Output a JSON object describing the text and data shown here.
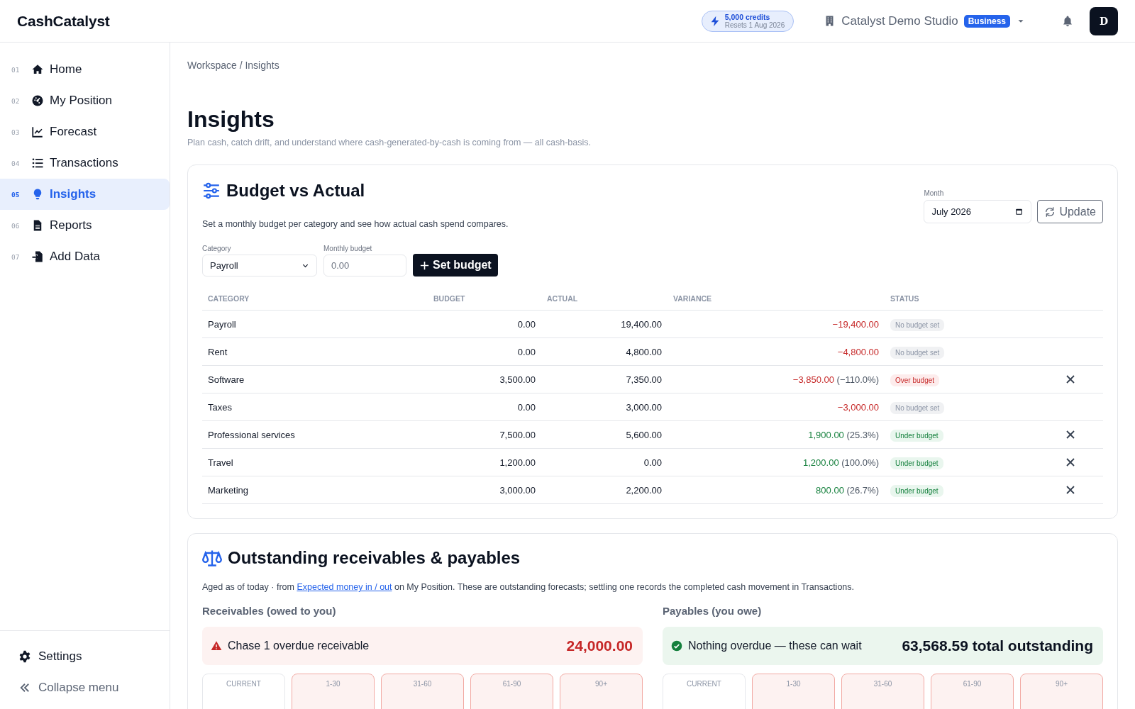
{
  "app": {
    "logo": "CashCatalyst"
  },
  "credits": {
    "amount": "5,000 credits",
    "reset": "Resets 1 Aug 2026"
  },
  "workspace": {
    "name": "Catalyst Demo Studio",
    "plan": "Business"
  },
  "user": {
    "initial": "D"
  },
  "sidebar": {
    "items": [
      {
        "number": "01",
        "label": "Home",
        "selected": false
      },
      {
        "number": "02",
        "label": "My Position",
        "selected": false
      },
      {
        "number": "03",
        "label": "Forecast",
        "selected": false
      },
      {
        "number": "04",
        "label": "Transactions",
        "selected": false
      },
      {
        "number": "05",
        "label": "Insights",
        "selected": true
      },
      {
        "number": "06",
        "label": "Reports",
        "selected": false
      },
      {
        "number": "07",
        "label": "Add Data",
        "selected": false
      }
    ],
    "footer": [
      {
        "label": "Settings"
      },
      {
        "label": "Collapse menu"
      }
    ]
  },
  "breadcrumb": "Workspace / Insights",
  "page": {
    "title": "Insights",
    "subtitle": "Plan cash, catch drift, and understand where cash-generated-by-cash is coming from — all cash-basis."
  },
  "budget": {
    "title": "Budget vs Actual",
    "description": "Set a monthly budget per category and see how actual cash spend compares.",
    "month": {
      "label": "Month",
      "value": "July 2026"
    },
    "update_button": "Update",
    "category": {
      "label": "Category",
      "value": "Payroll"
    },
    "monthly_budget": {
      "label": "Monthly budget",
      "placeholder": "0.00"
    },
    "set_button": "Set budget",
    "columns": [
      "CATEGORY",
      "BUDGET",
      "ACTUAL",
      "VARIANCE",
      "STATUS"
    ],
    "rows": [
      {
        "category": "Payroll",
        "budget": "0.00",
        "actual": "19,400.00",
        "variance": "−19,400.00",
        "status": "No budget set",
        "kind": "none",
        "removable": false
      },
      {
        "category": "Rent",
        "budget": "0.00",
        "actual": "4,800.00",
        "variance": "−4,800.00",
        "status": "No budget set",
        "kind": "none",
        "removable": false
      },
      {
        "category": "Software",
        "budget": "3,500.00",
        "actual": "7,350.00",
        "variance": "−3,850.00",
        "percent": "(−110.0%)",
        "status": "Over budget",
        "kind": "over",
        "removable": true
      },
      {
        "category": "Taxes",
        "budget": "0.00",
        "actual": "3,000.00",
        "variance": "−3,000.00",
        "status": "No budget set",
        "kind": "none",
        "removable": false
      },
      {
        "category": "Professional services",
        "budget": "7,500.00",
        "actual": "5,600.00",
        "variance": "1,900.00",
        "percent": "(25.3%)",
        "status": "Under budget",
        "kind": "under",
        "removable": true
      },
      {
        "category": "Travel",
        "budget": "1,200.00",
        "actual": "0.00",
        "variance": "1,200.00",
        "percent": "(100.0%)",
        "status": "Under budget",
        "kind": "under",
        "removable": true
      },
      {
        "category": "Marketing",
        "budget": "3,000.00",
        "actual": "2,200.00",
        "variance": "800.00",
        "percent": "(26.7%)",
        "status": "Under budget",
        "kind": "under",
        "removable": true
      }
    ]
  },
  "outstanding": {
    "title": "Outstanding receivables & payables",
    "description_before": "Aged as of today · from ",
    "link": "Expected money in / out",
    "description_after": " on My Position. These are outstanding forecasts; settling one records the completed cash movement in Transactions.",
    "groups": [
      {
        "heading": "Receivables (owed to you)",
        "alert": {
          "kind": "warning",
          "text": "Chase 1 overdue receivable",
          "amount": "24,000.00"
        },
        "buckets": [
          {
            "label": "CURRENT",
            "overdue": false
          },
          {
            "label": "1-30",
            "overdue": true
          },
          {
            "label": "31-60",
            "overdue": true
          },
          {
            "label": "61-90",
            "overdue": true
          },
          {
            "label": "90+",
            "overdue": true
          }
        ]
      },
      {
        "heading": "Payables (you owe)",
        "alert": {
          "kind": "ok",
          "text": "Nothing overdue — these can wait",
          "amount": "63,568.59 total outstanding"
        },
        "buckets": [
          {
            "label": "CURRENT",
            "overdue": false
          },
          {
            "label": "1-30",
            "overdue": true
          },
          {
            "label": "31-60",
            "overdue": true
          },
          {
            "label": "61-90",
            "overdue": true
          },
          {
            "label": "90+",
            "overdue": true
          }
        ]
      }
    ]
  }
}
